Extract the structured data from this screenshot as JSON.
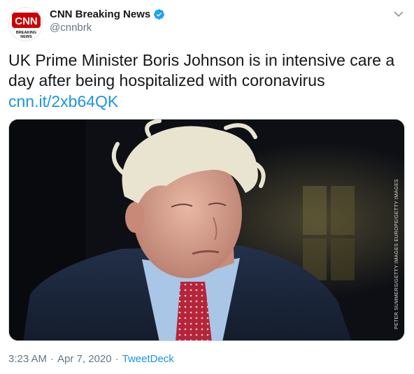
{
  "author": {
    "display_name": "CNN Breaking News",
    "handle": "@cnnbrk",
    "avatar_logo": "CNN",
    "avatar_caption_1": "BREAKING",
    "avatar_caption_2": "NEWS",
    "verified": true
  },
  "tweet": {
    "text": "UK Prime Minister Boris Johnson is in intensive care a day after being hospitalized with coronavirus",
    "link": "cnn.it/2xb64QK"
  },
  "media": {
    "photo_credit": "PETER SUMMERS/GETTY IMAGES EUROPE/GETTY IMAGES"
  },
  "meta": {
    "time": "3:23 AM",
    "separator": "·",
    "date": "Apr 7, 2020",
    "source": "TweetDeck"
  },
  "icons": {
    "verified": "verified-badge-icon",
    "caret": "chevron-down-icon"
  },
  "colors": {
    "link": "#1b95e0",
    "secondary_text": "#657786",
    "brand_red": "#cc0000"
  }
}
